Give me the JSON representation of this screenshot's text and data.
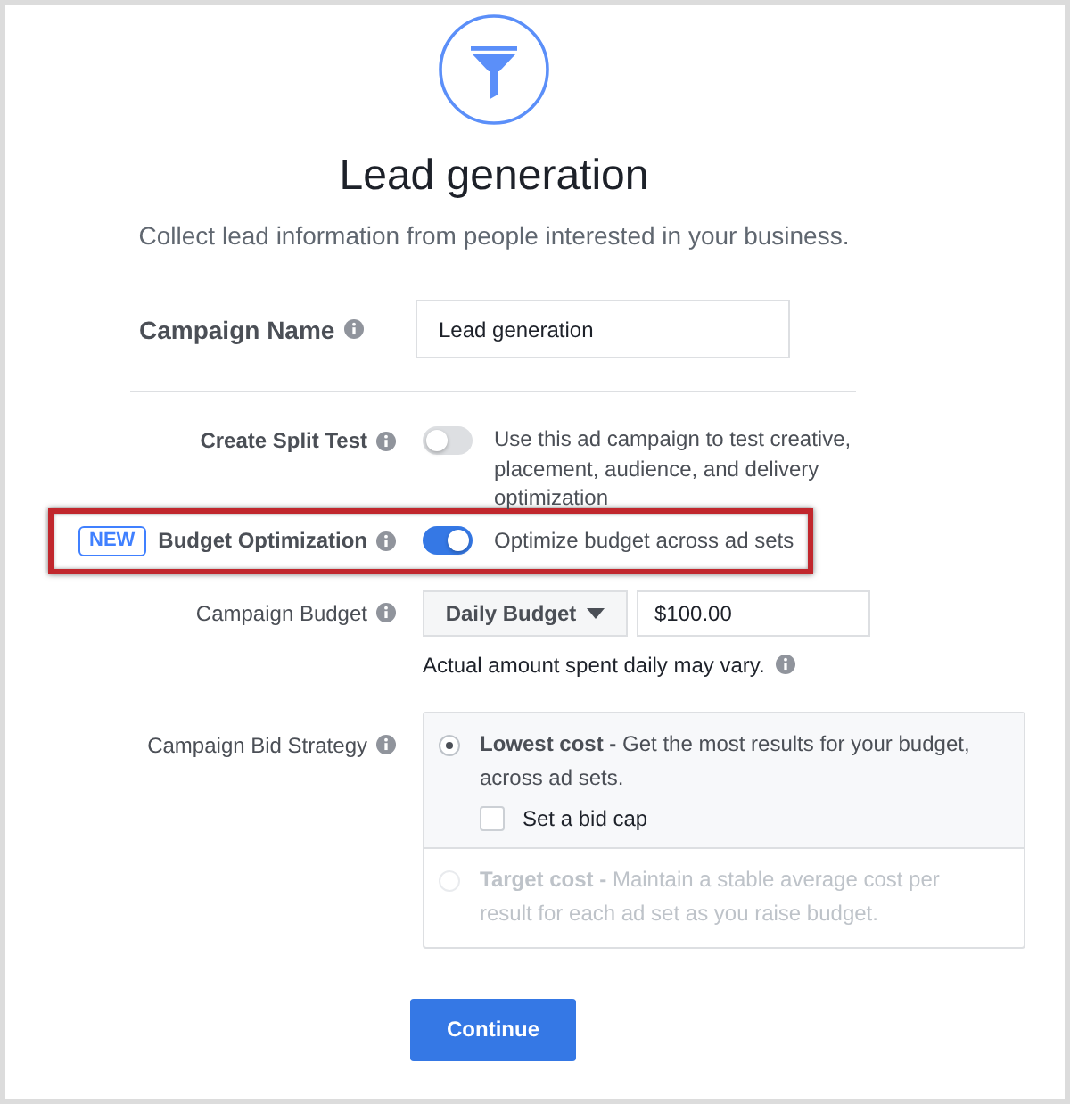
{
  "header": {
    "title": "Lead generation",
    "subtitle": "Collect lead information from people interested in your business."
  },
  "campaign_name": {
    "label": "Campaign Name",
    "value": "Lead generation"
  },
  "split_test": {
    "label": "Create Split Test",
    "on": false,
    "description": "Use this ad campaign to test creative, placement, audience, and delivery optimization"
  },
  "budget_optimization": {
    "highlighted": true,
    "badge": "NEW",
    "label": "Budget Optimization",
    "on": true,
    "description": "Optimize budget across ad sets"
  },
  "campaign_budget": {
    "label": "Campaign Budget",
    "budget_type": "Daily Budget",
    "amount": "$100.00",
    "note": "Actual amount spent daily may vary."
  },
  "bid_strategy": {
    "label": "Campaign Bid Strategy",
    "options": [
      {
        "text": "**Lowest cost -** Get the most results for your budget, across ad sets.",
        "selected": true,
        "disabled": false,
        "bid_cap": {
          "label": "Set a bid cap",
          "checked": false
        }
      },
      {
        "text": "**Target cost -** Maintain a stable average cost per result for each ad set as you raise budget.",
        "selected": false,
        "disabled": true
      }
    ]
  },
  "continue_button": "Continue"
}
